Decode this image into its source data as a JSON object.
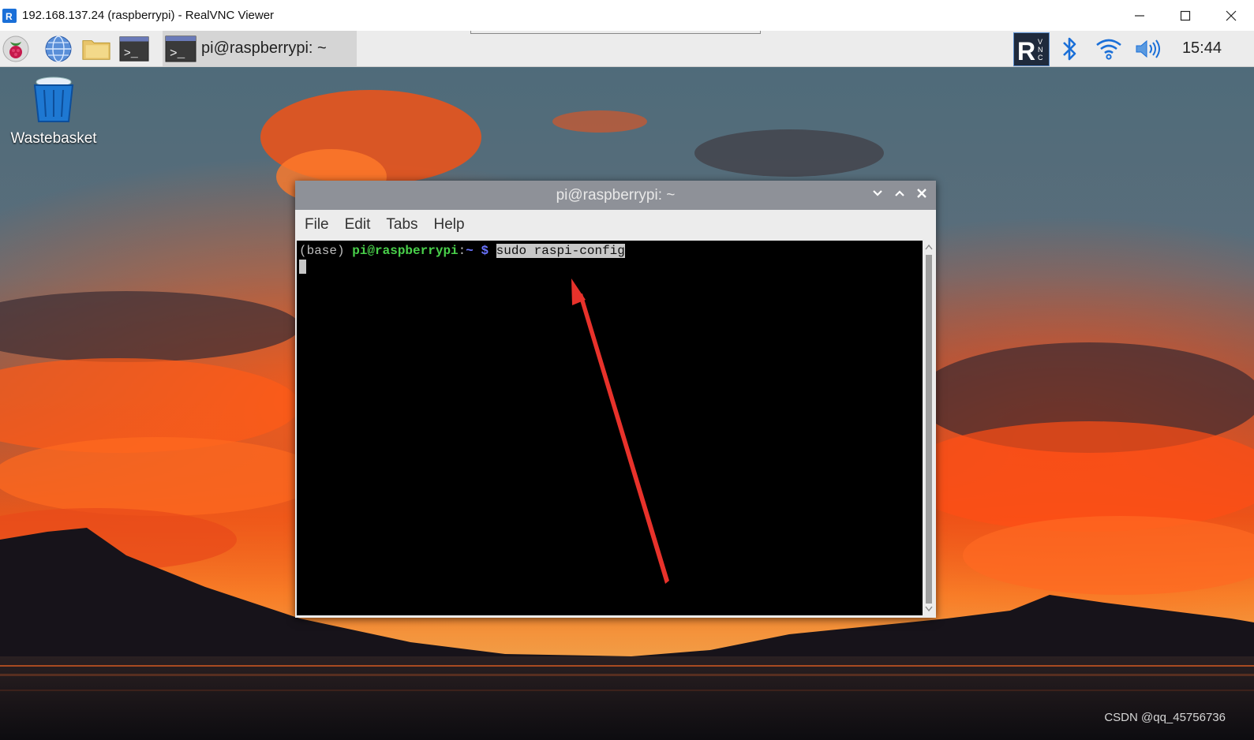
{
  "window": {
    "title": "192.168.137.24 (raspberrypi) - RealVNC Viewer"
  },
  "taskbar": {
    "apps": [
      "raspberry-menu",
      "web-browser",
      "file-manager",
      "terminal"
    ],
    "task_label": "pi@raspberrypi: ~",
    "clock": "15:44",
    "tray": [
      "realvnc-icon",
      "bluetooth-icon",
      "wifi-icon",
      "volume-icon"
    ]
  },
  "desktop": {
    "icons": [
      {
        "label": "Wastebasket"
      }
    ]
  },
  "terminal": {
    "title": "pi@raspberrypi: ~",
    "menu": [
      "File",
      "Edit",
      "Tabs",
      "Help"
    ],
    "prompt_env": "(base) ",
    "prompt_user": "pi@raspberrypi",
    "prompt_colon": ":",
    "prompt_path": "~ $ ",
    "command": "sudo raspi-config"
  },
  "annotation": {
    "color": "#e8322b"
  },
  "watermark": "CSDN @qq_45756736",
  "colors": {
    "sky": "#4b6473",
    "cloud_orange": "#f0561c",
    "terminal_bg": "#000000",
    "prompt_green": "#49d04a",
    "prompt_blue": "#6a74ff"
  }
}
